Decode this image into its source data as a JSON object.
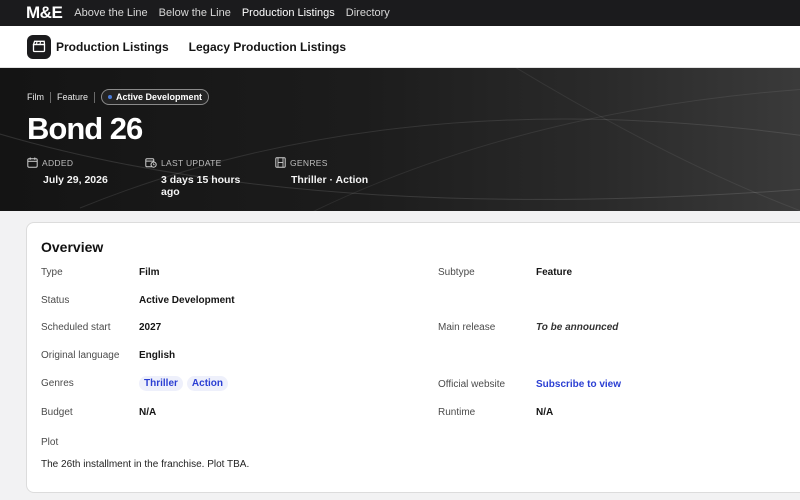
{
  "topbar": {
    "logo": "M&E",
    "nav": [
      "Above the Line",
      "Below the Line",
      "Production Listings",
      "Directory"
    ],
    "active": "Production Listings"
  },
  "subnav": {
    "primary": "Production Listings",
    "secondary": "Legacy Production Listings"
  },
  "hero": {
    "crumbs": [
      "Film",
      "Feature"
    ],
    "badge": "Active Development",
    "title": "Bond 26",
    "meta": [
      {
        "label": "ADDED",
        "value": "July 29, 2026",
        "icon": "calendar-icon"
      },
      {
        "label": "LAST UPDATE",
        "value": "3 days 15 hours ago",
        "icon": "calendar-clock-icon"
      },
      {
        "label": "GENRES",
        "value": "Thriller · Action",
        "icon": "film-icon"
      }
    ]
  },
  "overview": {
    "title": "Overview",
    "left": [
      {
        "label": "Type",
        "value": "Film"
      },
      {
        "label": "Status",
        "value": "Active Development"
      },
      {
        "label": "Scheduled start",
        "value": "2027"
      },
      {
        "label": "Original language",
        "value": "English"
      },
      {
        "label": "Genres",
        "tags": [
          "Thriller",
          "Action"
        ]
      },
      {
        "label": "Budget",
        "value": "N/A"
      }
    ],
    "right": [
      {
        "label": "Subtype",
        "value": "Feature"
      },
      {
        "label": "Main release",
        "value": "To be announced"
      },
      {
        "label": "Official website",
        "value": "Subscribe to view"
      },
      {
        "label": "Runtime",
        "value": "N/A"
      }
    ],
    "plot_label": "Plot",
    "plot_text": "The 26th installment in the franchise. Plot TBA."
  },
  "colors": {
    "topbar": "#1b1b1d",
    "accent_link": "#2b3fd3",
    "badge_dot": "#4a7bd8"
  }
}
